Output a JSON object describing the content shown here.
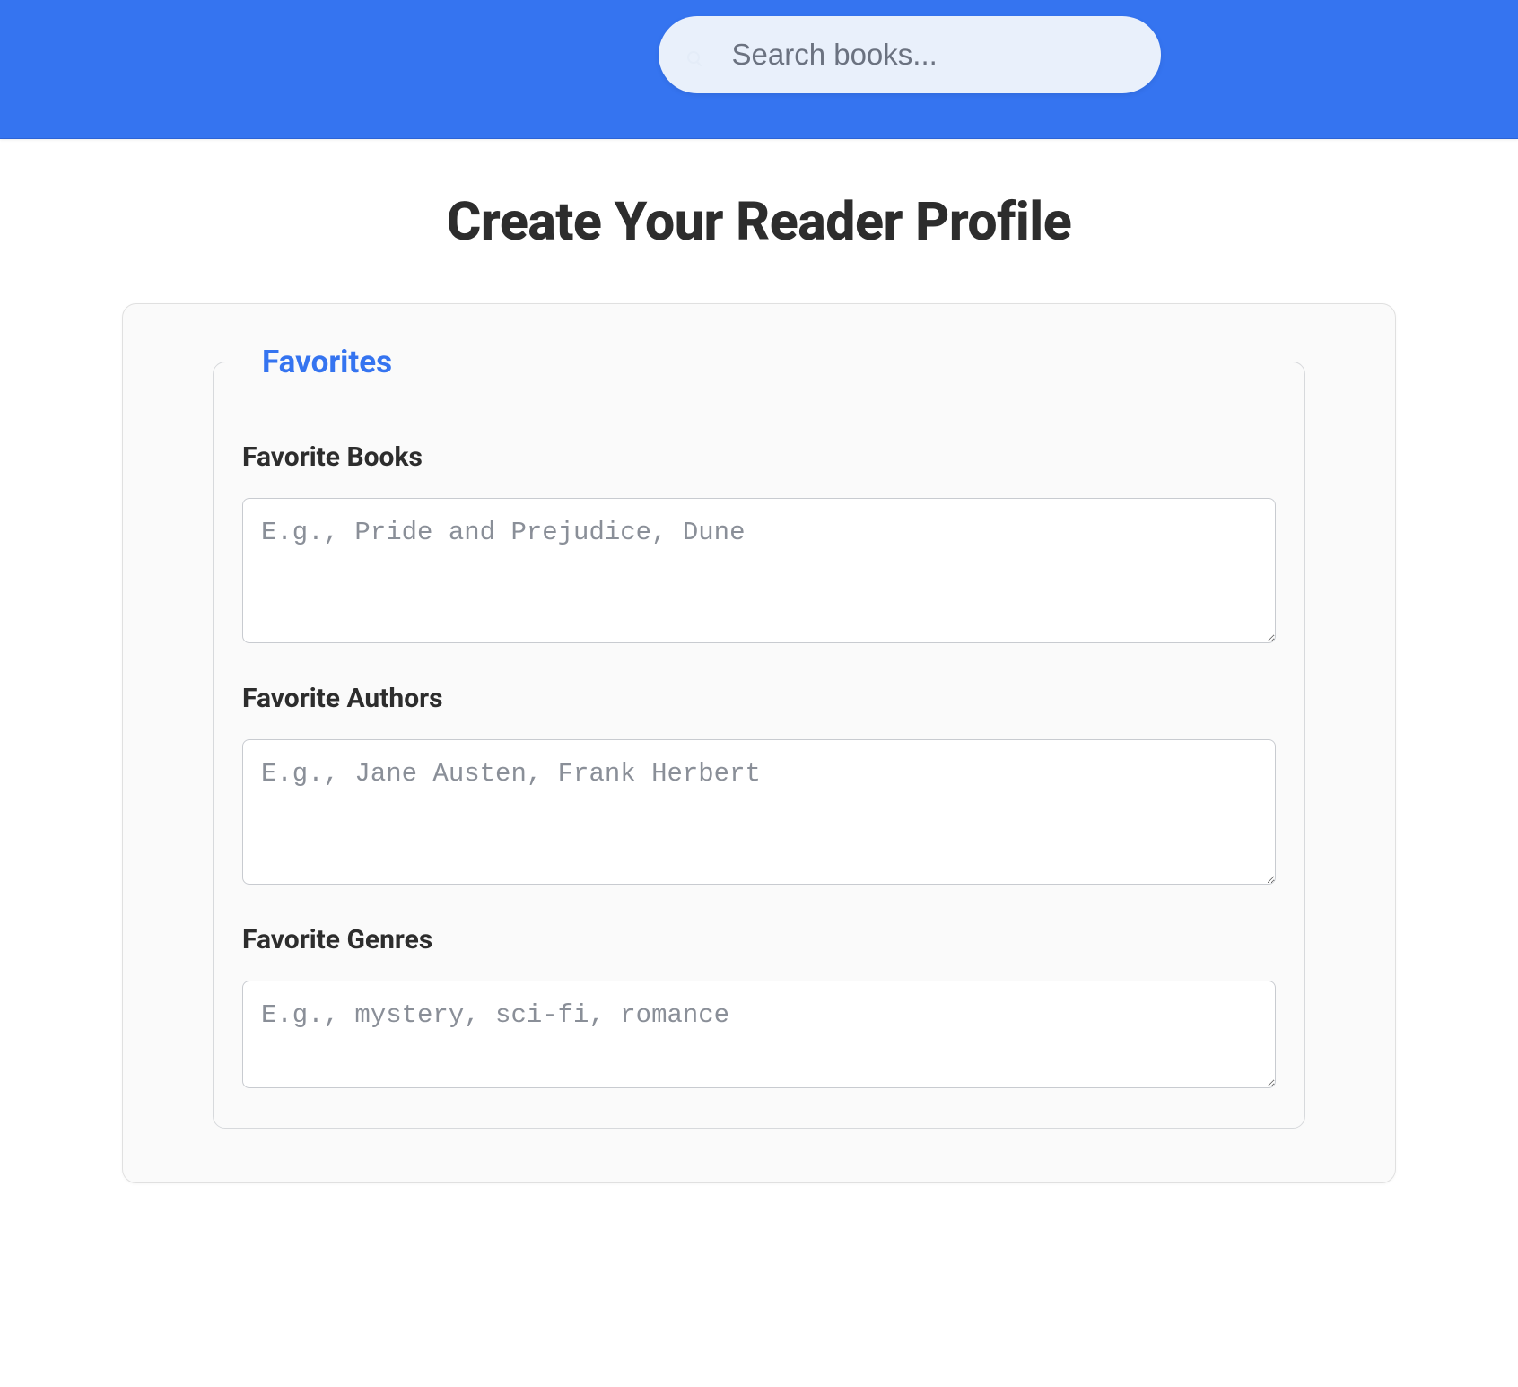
{
  "header": {
    "search_placeholder": "Search books..."
  },
  "page": {
    "title": "Create Your Reader Profile"
  },
  "favorites": {
    "legend": "Favorites",
    "fields": {
      "books": {
        "label": "Favorite Books",
        "placeholder": "E.g., Pride and Prejudice, Dune"
      },
      "authors": {
        "label": "Favorite Authors",
        "placeholder": "E.g., Jane Austen, Frank Herbert"
      },
      "genres": {
        "label": "Favorite Genres",
        "placeholder": "E.g., mystery, sci-fi, romance"
      }
    }
  }
}
